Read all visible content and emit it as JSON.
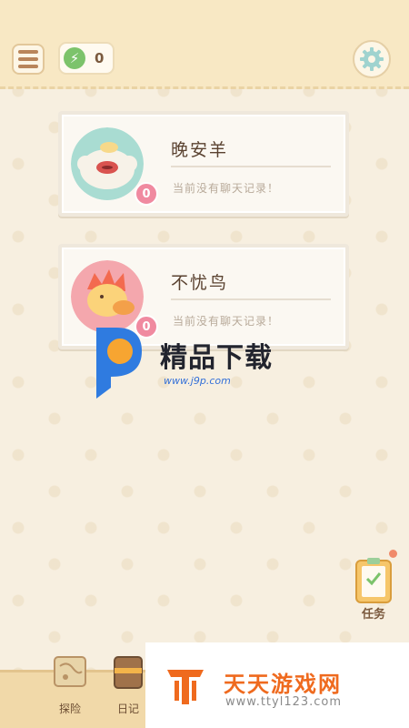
{
  "header": {
    "energy_count": "0"
  },
  "chats": [
    {
      "name": "晚安羊",
      "preview": "当前没有聊天记录！",
      "affinity": "0"
    },
    {
      "name": "不忧鸟",
      "preview": "当前没有聊天记录！",
      "affinity": "0"
    }
  ],
  "watermark": {
    "title": "精品下载",
    "url": "www.j9p.com"
  },
  "task_button": {
    "label": "任务"
  },
  "bottom_nav": [
    {
      "label": "探险"
    },
    {
      "label": "日记"
    }
  ],
  "site_banner": {
    "name": "天天游戏网",
    "url": "www.ttyl123.com"
  },
  "colors": {
    "background": "#f7efe0",
    "topbar": "#f8e8c4",
    "accent_green": "#7cc36b",
    "heart_pink": "#f08aa0",
    "site_orange": "#ef6a1e",
    "watermark_blue": "#3470d8"
  }
}
